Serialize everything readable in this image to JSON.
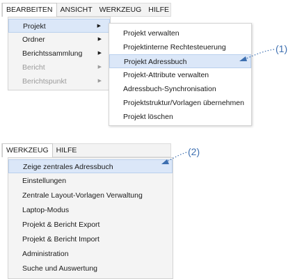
{
  "menubar_top": {
    "items": [
      "BEARBEITEN",
      "ANSICHT",
      "WERKZEUG",
      "HILFE"
    ],
    "active_index": 0
  },
  "bearbeiten_menu": {
    "items": [
      {
        "label": "Projekt",
        "submenu": true,
        "disabled": false,
        "highlighted": true
      },
      {
        "label": "Ordner",
        "submenu": true,
        "disabled": false,
        "highlighted": false
      },
      {
        "label": "Berichtssammlung",
        "submenu": true,
        "disabled": false,
        "highlighted": false
      },
      {
        "label": "Bericht",
        "submenu": true,
        "disabled": true,
        "highlighted": false
      },
      {
        "label": "Berichtspunkt",
        "submenu": true,
        "disabled": true,
        "highlighted": false
      }
    ]
  },
  "projekt_submenu": {
    "items": [
      {
        "label": "Projekt verwalten",
        "highlighted": false
      },
      {
        "label": "Projektinterne Rechtesteuerung",
        "highlighted": false
      },
      {
        "label": "Projekt Adressbuch",
        "highlighted": true
      },
      {
        "label": "Projekt-Attribute verwalten",
        "highlighted": false
      },
      {
        "label": "Adressbuch-Synchronisation",
        "highlighted": false
      },
      {
        "label": "Projektstruktur/Vorlagen übernehmen",
        "highlighted": false
      },
      {
        "label": "Projekt löschen",
        "highlighted": false
      }
    ]
  },
  "callout_1": "(1)",
  "menubar_bottom": {
    "items": [
      "WERKZEUG",
      "HILFE"
    ],
    "active_index": 0
  },
  "werkzeug_menu": {
    "items": [
      {
        "label": "Zeige zentrales Adressbuch",
        "highlighted": true
      },
      {
        "label": "Einstellungen",
        "highlighted": false
      },
      {
        "label": "Zentrale Layout-Vorlagen Verwaltung",
        "highlighted": false
      },
      {
        "label": "Laptop-Modus",
        "highlighted": false
      },
      {
        "label": "Projekt & Bericht Export",
        "highlighted": false
      },
      {
        "label": "Projekt & Bericht Import",
        "highlighted": false
      },
      {
        "label": "Administration",
        "highlighted": false
      },
      {
        "label": "Suche und Auswertung",
        "highlighted": false
      }
    ]
  },
  "callout_2": "(2)",
  "colors": {
    "highlight": "#dbe7f8",
    "callout": "#3d6fb0",
    "disabled_text": "#9a9a9a"
  }
}
